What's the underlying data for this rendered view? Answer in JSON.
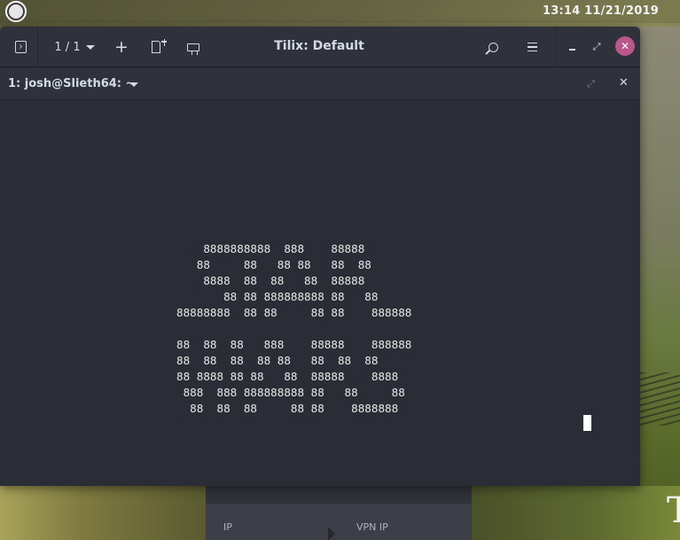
{
  "top_panel": {
    "clock": "13:14 11/21/2019"
  },
  "window": {
    "title": "Tilix: Default",
    "session_count": "1 / 1",
    "add_label": "+",
    "maximize_glyph": "⤢",
    "close_glyph": "✕",
    "close_color": "#b8578a"
  },
  "terminal": {
    "title": "1: josh@Slieth64: ~",
    "maximize_glyph": "⤢",
    "close_glyph": "✕",
    "ascii_lines": [
      "    8888888888  888    88888",
      "   88     88   88 88   88  88",
      "    8888  88  88   88  88888",
      "       88 88 888888888 88   88",
      "88888888  88 88     88 88    888888",
      "",
      "88  88  88   888    88888    888888",
      "88  88  88  88 88   88  88  88",
      "88 8888 88 88   88  88888    8888",
      " 888  888 888888888 88   88     88",
      "  88  88  88     88 88    8888888"
    ]
  },
  "background_app": {
    "ip_label": "IP",
    "vpn_ip_label": "VPN IP"
  },
  "desktop": {
    "corner_letter": "T"
  }
}
